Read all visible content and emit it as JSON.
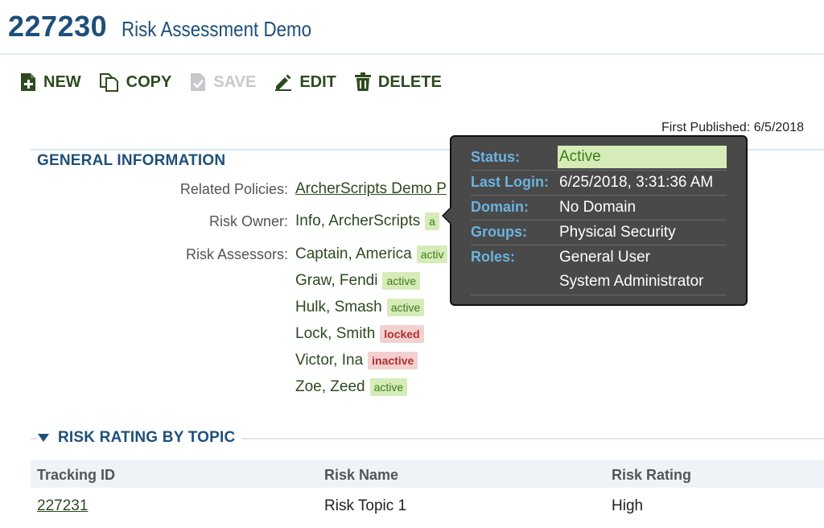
{
  "header": {
    "record_id": "227230",
    "title": "Risk Assessment Demo"
  },
  "toolbar": {
    "new": "NEW",
    "copy": "COPY",
    "save": "SAVE",
    "edit": "EDIT",
    "delete": "DELETE"
  },
  "first_published": "First Published: 6/5/2018",
  "general": {
    "section_title": "GENERAL INFORMATION",
    "related_policies_label": "Related Policies:",
    "related_policies_value": "ArcherScripts Demo P",
    "risk_owner_label": "Risk Owner:",
    "risk_owner_value": "Info, ArcherScripts",
    "risk_owner_badge": "a",
    "risk_assessors_label": "Risk Assessors:",
    "assessors": [
      {
        "name": "Captain, America",
        "status": "activ"
      },
      {
        "name": "Graw, Fendi",
        "status": "active"
      },
      {
        "name": "Hulk, Smash",
        "status": "active"
      },
      {
        "name": "Lock, Smith",
        "status": "locked"
      },
      {
        "name": "Victor, Ina",
        "status": "inactive"
      },
      {
        "name": "Zoe, Zeed",
        "status": "active"
      }
    ]
  },
  "popup": {
    "status_label": "Status:",
    "status_value": "Active",
    "last_login_label": "Last Login:",
    "last_login_value": "6/25/2018, 3:31:36 AM",
    "domain_label": "Domain:",
    "domain_value": "No Domain",
    "groups_label": "Groups:",
    "groups_value": "Physical Security",
    "roles_label": "Roles:",
    "roles_values": [
      "General User",
      "System Administrator"
    ]
  },
  "risk_rating": {
    "section_title": "RISK RATING BY TOPIC",
    "columns": [
      "Tracking ID",
      "Risk Name",
      "Risk Rating"
    ],
    "rows": [
      {
        "tracking_id": "227231",
        "risk_name": "Risk Topic 1",
        "risk_rating": "High"
      }
    ]
  },
  "colors": {
    "brand_blue": "#1e4f7a",
    "text_green": "#2d4a1f",
    "active_bg": "#d6ecb8",
    "alert_bg": "#f3d0d0",
    "popup_bg": "#494949",
    "popup_key": "#6bb3e0"
  },
  "icons": [
    "new-icon",
    "copy-icon",
    "save-icon",
    "edit-icon",
    "delete-icon",
    "collapse-triangle-icon"
  ]
}
